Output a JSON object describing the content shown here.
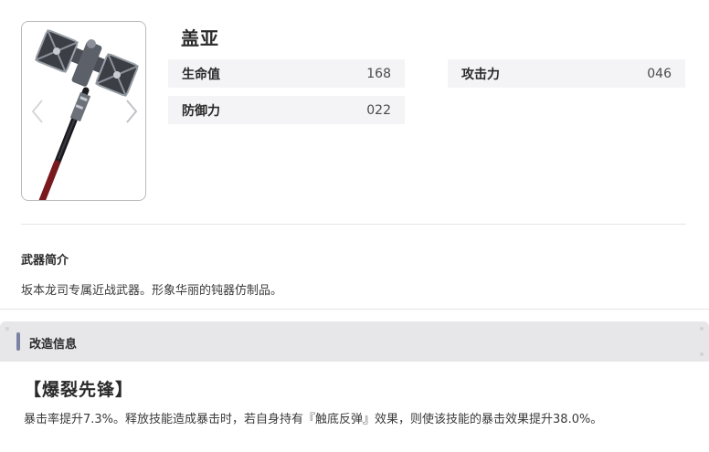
{
  "weapon": {
    "name": "盖亚",
    "icon": "hammer-weapon-image",
    "stats": {
      "hp": {
        "label": "生命值",
        "value": "168"
      },
      "atk": {
        "label": "攻击力",
        "value": "046"
      },
      "def": {
        "label": "防御力",
        "value": "022"
      }
    }
  },
  "intro": {
    "title": "武器简介",
    "text": "坂本龙司专属近战武器。形象华丽的钝器仿制品。"
  },
  "modification": {
    "title": "改造信息",
    "accent_color": "#7b82a3"
  },
  "skill": {
    "name": "【爆裂先锋】",
    "description": "暴击率提升7.3%。释放技能造成暴击时，若自身持有『触底反弹』效果，则使该技能的暴击效果提升38.0%。"
  }
}
